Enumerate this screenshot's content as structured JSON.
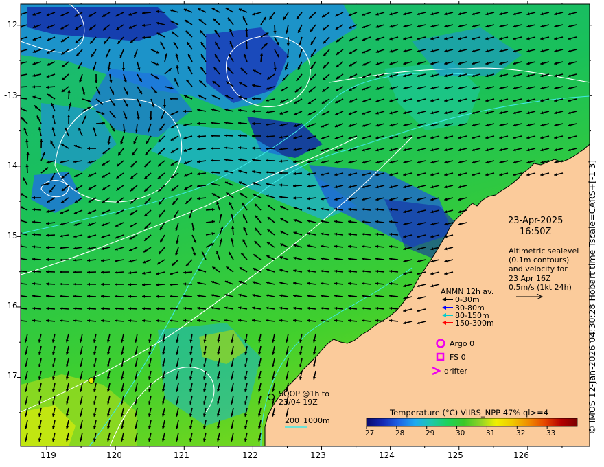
{
  "chart_data": {
    "type": "map",
    "x_axis": {
      "ticks": [
        "119",
        "120",
        "121",
        "122",
        "123",
        "124",
        "125",
        "126"
      ],
      "range": [
        118.62,
        126.9
      ]
    },
    "y_axis": {
      "ticks": [
        "-12",
        "-13",
        "-14",
        "-15",
        "-16",
        "-17"
      ],
      "range": [
        -11.7,
        -17.98
      ]
    },
    "timestamp": {
      "date": "23-Apr-2025",
      "time": "16:50Z"
    },
    "sealevel_note": [
      "Altimetric sealevel",
      "(0.1m contours)",
      "and velocity for",
      "23 Apr 16Z",
      "0.5m/s (1kt 24h)"
    ],
    "anmn_legend": {
      "title": "ANMN 12h av.",
      "items": [
        {
          "label": "0-30m",
          "color": "#000000"
        },
        {
          "label": "30-80m",
          "color": "#0000ff"
        },
        {
          "label": "80-150m",
          "color": "#00cccc"
        },
        {
          "label": "150-300m",
          "color": "#ff0000"
        }
      ]
    },
    "markers": [
      {
        "label": "Argo 0",
        "symbol": "circle",
        "color": "#ee00ee"
      },
      {
        "label": "FS 0",
        "symbol": "square",
        "color": "#ee00ee"
      },
      {
        "label": "drifter",
        "symbol": "chevron",
        "color": "#ee00ee"
      }
    ],
    "soop_note": [
      "SOOP @1h to",
      "23/04 19Z"
    ],
    "bathymetry_legend": {
      "labels": [
        "200",
        "1000m"
      ]
    },
    "colorbar": {
      "title": "Temperature (°C) VIIRS_NPP 47% ql>=4",
      "range": [
        27,
        34
      ],
      "ticks": [
        "27",
        "28",
        "29",
        "30",
        "31",
        "32",
        "33"
      ],
      "stops": [
        "#0a0a6e",
        "#1428b4",
        "#1e64e6",
        "#1eaaf0",
        "#1ec8aa",
        "#1ed25a",
        "#3cc828",
        "#8cd228",
        "#f0f000",
        "#f0c800",
        "#f08c00",
        "#e64600",
        "#b40000",
        "#7a0000"
      ]
    },
    "credit": "© IMOS 12-Jan-2026 04:30:28 Hobart time Tscale=CARS+[-1 3]"
  }
}
